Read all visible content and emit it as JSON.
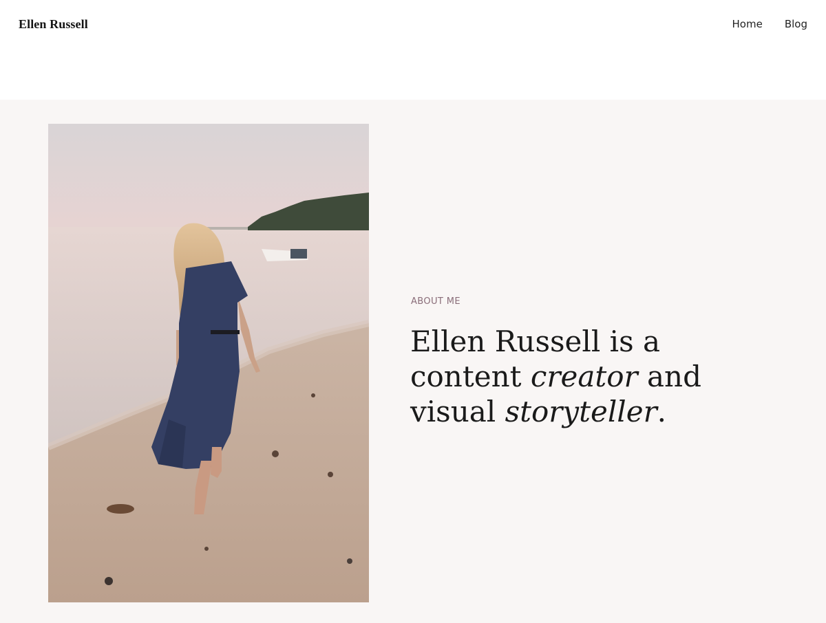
{
  "header": {
    "brand": "Ellen Russell",
    "nav": [
      {
        "label": "Home"
      },
      {
        "label": "Blog"
      }
    ]
  },
  "hero": {
    "eyebrow": "ABOUT ME",
    "headline": {
      "part1": "Ellen Russell is a content ",
      "em1": "creator",
      "part2": " and visual ",
      "em2": "storyteller",
      "part3": "."
    },
    "photo": {
      "subject": "woman in navy dress walking barefoot on beach at dusk"
    }
  },
  "colors": {
    "page_background": "#ffffff",
    "hero_background": "#f9f6f5",
    "eyebrow": "#8a6d79",
    "text": "#1a1a1a"
  }
}
